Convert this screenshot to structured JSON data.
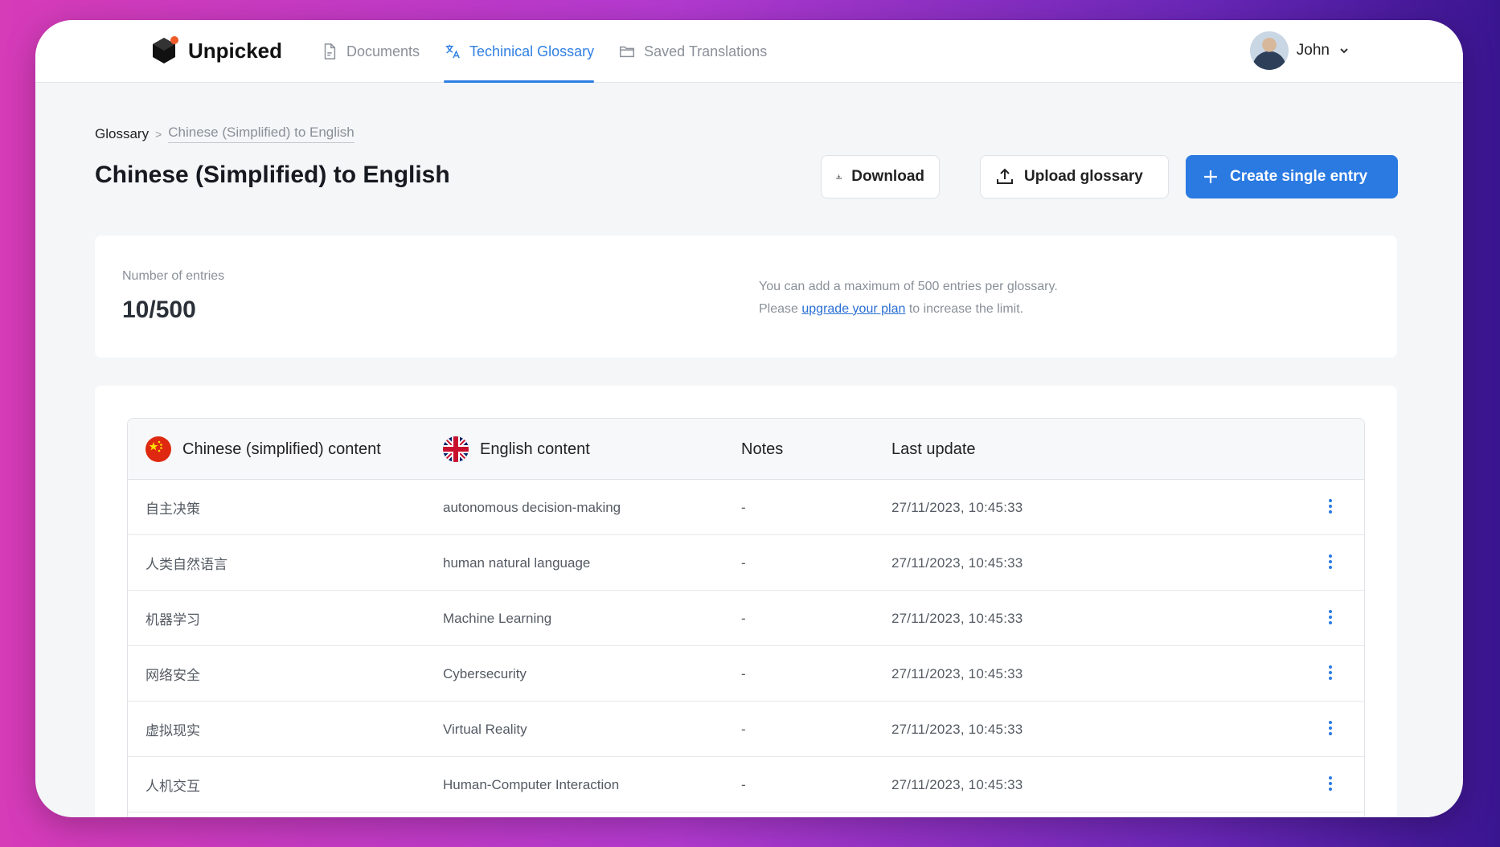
{
  "app": {
    "name": "Unpicked",
    "nav": [
      {
        "label": "Documents",
        "icon": "document-icon",
        "active": false
      },
      {
        "label": "Techinical Glossary",
        "icon": "translate-icon",
        "active": true
      },
      {
        "label": "Saved Translations",
        "icon": "folder-icon",
        "active": false
      }
    ],
    "user": {
      "name": "John"
    }
  },
  "breadcrumb": {
    "root": "Glossary",
    "separator": ">",
    "current": "Chinese (Simplified) to English"
  },
  "page": {
    "title": "Chinese (Simplified) to English"
  },
  "actions": {
    "download": "Download",
    "upload": "Upload glossary",
    "create": "Create single entry"
  },
  "stats": {
    "label": "Number of entries",
    "value": "10/500",
    "note_line1": "You can add a maximum of 500 entries per glossary.",
    "note_prefix": "Please",
    "note_link": "upgrade your plan",
    "note_suffix": "to increase the limit."
  },
  "table": {
    "columns": {
      "source": "Chinese (simplified) content",
      "target": "English content",
      "notes": "Notes",
      "updated": "Last update"
    },
    "rows": [
      {
        "source": "自主决策",
        "target": "autonomous decision-making",
        "notes": "-",
        "updated": "27/11/2023, 10:45:33"
      },
      {
        "source": "人类自然语言",
        "target": "human natural language",
        "notes": "-",
        "updated": "27/11/2023, 10:45:33"
      },
      {
        "source": "机器学习",
        "target": "Machine Learning",
        "notes": "-",
        "updated": "27/11/2023, 10:45:33"
      },
      {
        "source": "网络安全",
        "target": "Cybersecurity",
        "notes": "-",
        "updated": "27/11/2023, 10:45:33"
      },
      {
        "source": "虚拟现实",
        "target": "Virtual Reality",
        "notes": "-",
        "updated": "27/11/2023, 10:45:33"
      },
      {
        "source": "人机交互",
        "target": "Human-Computer Interaction",
        "notes": "-",
        "updated": "27/11/2023, 10:45:33"
      }
    ]
  },
  "colors": {
    "accent": "#2a7ae2",
    "muted": "#8a9099"
  }
}
